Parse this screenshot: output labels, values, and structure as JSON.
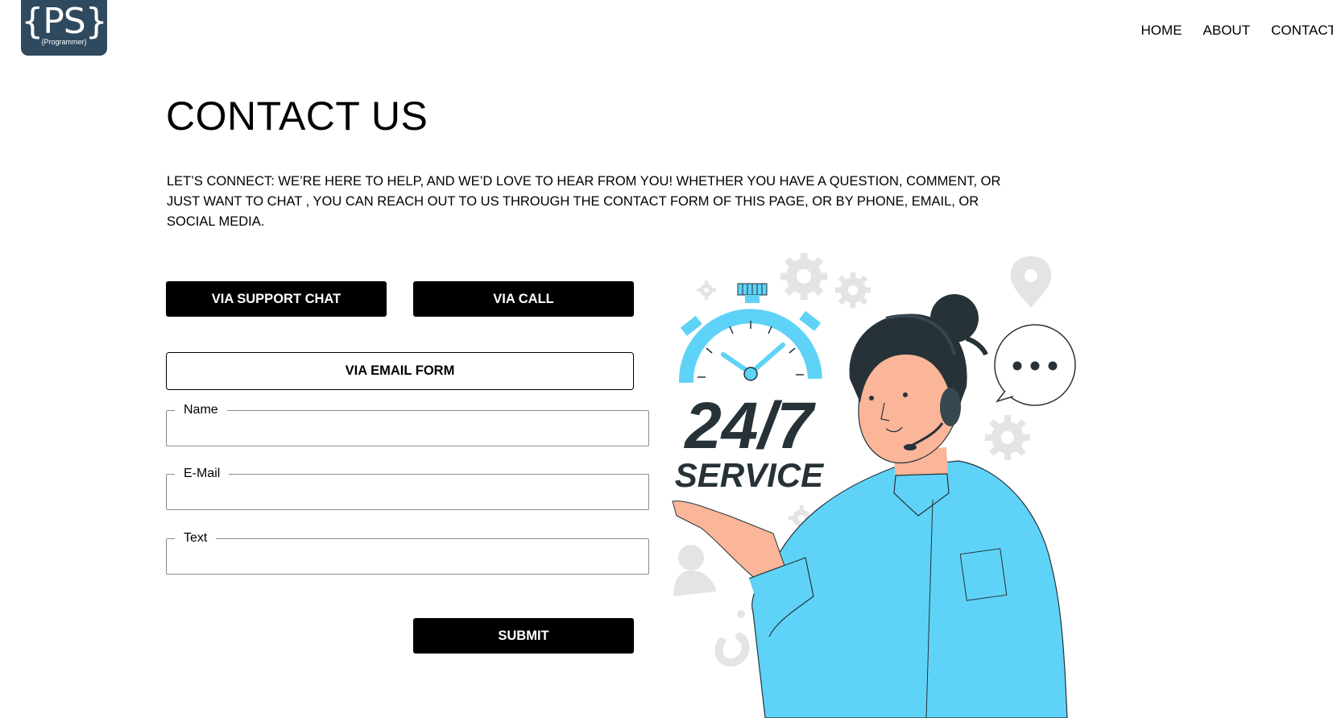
{
  "logo": {
    "main": "{PS}",
    "sub": "{Programmer}"
  },
  "nav": {
    "items": [
      "HOME",
      "ABOUT",
      "CONTACT"
    ]
  },
  "page": {
    "title": "CONTACT US",
    "intro": "LET’S CONNECT: WE’RE HERE TO HELP, AND WE’D LOVE TO HEAR FROM YOU! WHETHER YOU HAVE A QUESTION, COMMENT, OR JUST WANT TO CHAT , YOU CAN REACH OUT TO US THROUGH THE CONTACT FORM OF THIS PAGE, OR BY PHONE, EMAIL, OR SOCIAL MEDIA."
  },
  "buttons": {
    "chat": "VIA SUPPORT CHAT",
    "call": "VIA CALL",
    "email": "VIA EMAIL FORM",
    "submit": "SUBMIT"
  },
  "form": {
    "name": {
      "label": "Name",
      "value": ""
    },
    "email": {
      "label": "E-Mail",
      "value": ""
    },
    "text": {
      "label": "Text",
      "value": ""
    }
  },
  "illustration": {
    "line1": "24/7",
    "line2": "SERVICE",
    "icons": [
      "stopwatch-icon",
      "gear-icon",
      "location-pin-icon",
      "speech-bubble-icon",
      "user-icon",
      "question-mark-icon"
    ]
  },
  "colors": {
    "logo_bg": "#2f4a5f",
    "button_bg": "#000000",
    "accent_blue": "#5fd3f7",
    "dark_text": "#263238"
  }
}
